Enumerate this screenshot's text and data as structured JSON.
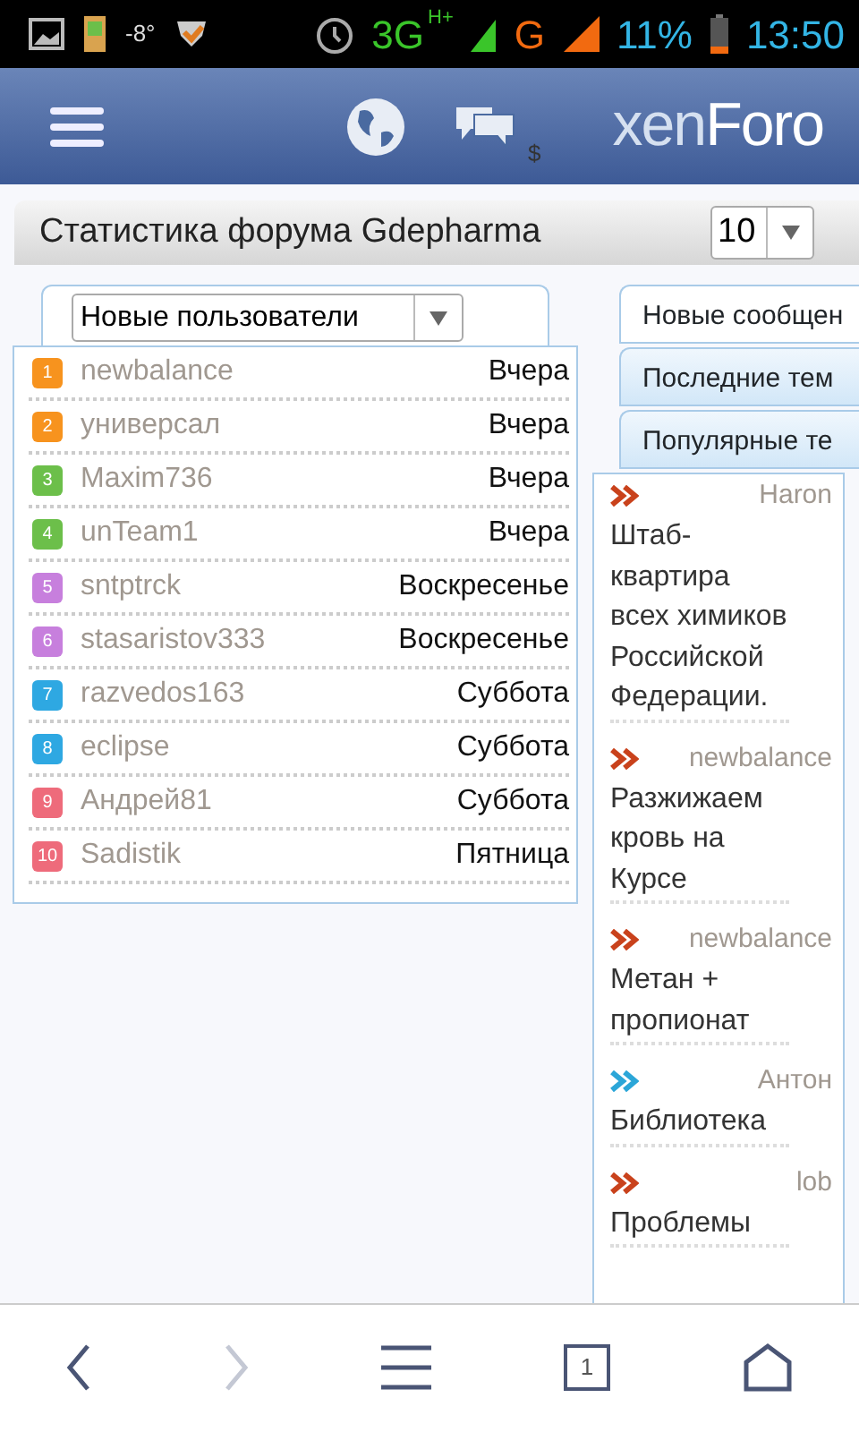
{
  "status_bar": {
    "temperature": "-8°",
    "network": "3G",
    "network_sup": "H+",
    "network2": "G",
    "battery": "11%",
    "time": "13:50"
  },
  "header": {
    "logo_main": "xen",
    "logo_accent": "Foro",
    "currency": "$"
  },
  "stats": {
    "title": "Статистика форума Gdepharma",
    "count_select": "10",
    "users_select": "Новые пользователи",
    "users": [
      {
        "rank": "1",
        "color": "#f7931e",
        "name": "newbalance",
        "date": "Вчера"
      },
      {
        "rank": "2",
        "color": "#f7931e",
        "name": "универсал",
        "date": "Вчера"
      },
      {
        "rank": "3",
        "color": "#6cbf4a",
        "name": "Maxim736",
        "date": "Вчера"
      },
      {
        "rank": "4",
        "color": "#6cbf4a",
        "name": "unTeam1",
        "date": "Вчера"
      },
      {
        "rank": "5",
        "color": "#c77fdd",
        "name": "sntptrck",
        "date": "Воскресенье"
      },
      {
        "rank": "6",
        "color": "#c77fdd",
        "name": "stasaristov333",
        "date": "Воскресенье"
      },
      {
        "rank": "7",
        "color": "#2ea8e2",
        "name": "razvedos163",
        "date": "Суббота"
      },
      {
        "rank": "8",
        "color": "#2ea8e2",
        "name": "eclipse",
        "date": "Суббота"
      },
      {
        "rank": "9",
        "color": "#ee6b7b",
        "name": "Андрей81",
        "date": "Суббота"
      },
      {
        "rank": "10",
        "color": "#ee6b7b",
        "name": "Sadistik",
        "date": "Пятница"
      }
    ],
    "tabs": [
      {
        "label": "Новые сообщен",
        "selected": true
      },
      {
        "label": "Последние тем",
        "selected": false
      },
      {
        "label": "Популярные те",
        "selected": false
      }
    ],
    "threads": [
      {
        "color": "#c9421c",
        "title": "Штаб-квартира всех химиков Российской Федерации.",
        "author": "Haron"
      },
      {
        "color": "#c9421c",
        "title": "Разжижаем кровь на Курсе",
        "author": "newbalance"
      },
      {
        "color": "#c9421c",
        "title": "Метан + пропионат",
        "author": "newbalance"
      },
      {
        "color": "#2ba6d8",
        "title": "Библиотека",
        "author": "Антон"
      },
      {
        "color": "#c9421c",
        "title": "Проблемы",
        "author": "lob"
      }
    ]
  },
  "nav_bar": {
    "tab_count": "1",
    "forward_disabled": true
  }
}
